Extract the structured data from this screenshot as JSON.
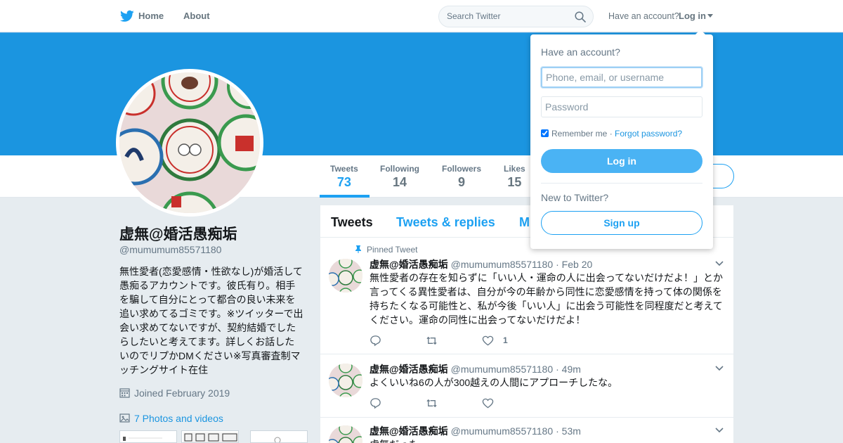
{
  "topnav": {
    "home_label": "Home",
    "about_label": "About",
    "search_placeholder": "Search Twitter",
    "have_account": "Have an account?",
    "login_label": "Log in"
  },
  "profile_nav": {
    "stats": [
      {
        "label": "Tweets",
        "value": "73"
      },
      {
        "label": "Following",
        "value": "14"
      },
      {
        "label": "Followers",
        "value": "9"
      },
      {
        "label": "Likes",
        "value": "15"
      }
    ]
  },
  "profile": {
    "name": "虚無@婚活愚痴垢",
    "handle": "@mumumum85571180",
    "bio": "無性愛者(恋愛感情・性欲なし)が婚活して愚痴るアカウントです。彼氏有り。相手を騙して自分にとって都合の良い未来を追い求めてるゴミです。※ツイッターで出会い求めてないですが、契約結婚でしたらしたいと考えてます。詳しくお話したいのでリプかDMください※写真審査制マッチングサイト在住",
    "joined": "Joined February 2019",
    "photos_link": "7 Photos and videos"
  },
  "timeline": {
    "tabs": [
      "Tweets",
      "Tweets & replies",
      "M"
    ],
    "pinned_label": "Pinned Tweet",
    "tweets": [
      {
        "name": "虚無@婚活愚痴垢",
        "handle": "@mumumum85571180",
        "time": "· Feb 20",
        "text": "無性愛者の存在を知らずに「いい人・運命の人に出会ってないだけだよ！」とか言ってくる異性愛者は、自分が今の年齢から同性に恋愛感情を持って体の関係を持ちたくなる可能性と、私が今後「いい人」に出会う可能性を同程度だと考えてください。運命の同性に出会ってないだけだよ！",
        "likes": "1"
      },
      {
        "name": "虚無@婚活愚痴垢",
        "handle": "@mumumum85571180",
        "time": "· 49m",
        "text": "よくいいね6の人が300越えの人間にアプローチしたな。",
        "likes": ""
      },
      {
        "name": "虚無@婚活愚痴垢",
        "handle": "@mumumum85571180",
        "time": "· 53m",
        "text": "虚無だった",
        "likes": ""
      }
    ]
  },
  "login_dropdown": {
    "title": "Have an account?",
    "username_placeholder": "Phone, email, or username",
    "password_placeholder": "Password",
    "remember_label": "Remember me",
    "separator": " · ",
    "forgot_label": "Forgot password?",
    "login_button": "Log in",
    "new_label": "New to Twitter?",
    "signup_button": "Sign up"
  },
  "colors": {
    "banner": "#1b95e0",
    "accent": "#1da1f2",
    "background": "#e6ecf0"
  }
}
